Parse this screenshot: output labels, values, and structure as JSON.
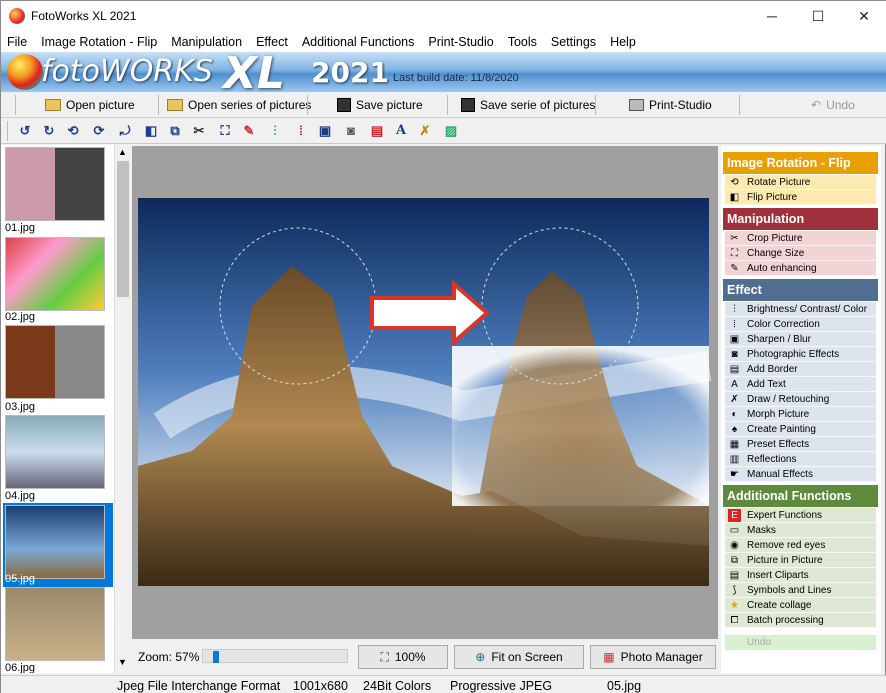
{
  "window": {
    "title": "FotoWorks XL 2021",
    "minimize": "─",
    "maximize": "☐",
    "close": "✕"
  },
  "menu": [
    "File",
    "Image Rotation - Flip",
    "Manipulation",
    "Effect",
    "Additional Functions",
    "Print-Studio",
    "Tools",
    "Settings",
    "Help"
  ],
  "banner": {
    "logo": "fotoWORKS",
    "xl": "XL",
    "year": "2021",
    "build": "Last build date: 11/8/2020"
  },
  "toolbar": {
    "open": "Open picture",
    "open_series": "Open series of pictures",
    "save": "Save picture",
    "save_series": "Save serie of pictures",
    "print": "Print-Studio",
    "undo": "Undo"
  },
  "thumbs": [
    "01.jpg",
    "02.jpg",
    "03.jpg",
    "04.jpg",
    "05.jpg",
    "06.jpg"
  ],
  "selected_thumb": "05.jpg",
  "zoom": {
    "label": "Zoom: 57%",
    "value": 57,
    "btn_100": "100%",
    "btn_fit": "Fit on Screen",
    "btn_pm": "Photo Manager"
  },
  "sidebar": {
    "g1": {
      "title": "Image Rotation - Flip",
      "color": "#e8a000",
      "bg": "#fdeab0",
      "items": [
        "Rotate Picture",
        "Flip Picture"
      ]
    },
    "g2": {
      "title": "Manipulation",
      "color": "#a0303c",
      "bg": "#f3d4d4",
      "items": [
        "Crop Picture",
        "Change Size",
        "Auto enhancing"
      ]
    },
    "g3": {
      "title": "Effect",
      "color": "#4f6e90",
      "bg": "#dce5ee",
      "items": [
        "Brightness/ Contrast/ Color",
        "Color Correction",
        "Sharpen / Blur",
        "Photographic Effects",
        "Add Border",
        "Add Text",
        "Draw / Retouching",
        "Morph Picture",
        "Create Painting",
        "Preset Effects",
        "Reflections",
        "Manual Effects"
      ]
    },
    "g4": {
      "title": "Additional Functions",
      "color": "#5e8a3c",
      "bg": "#dfe8d4",
      "items": [
        "Expert Functions",
        "Masks",
        "Remove red eyes",
        "Picture in Picture",
        "Insert Cliparts",
        "Symbols and Lines",
        "Create collage",
        "Batch processing"
      ]
    },
    "undo": "Undo"
  },
  "status": {
    "format": "Jpeg File Interchange Format",
    "dims": "1001x680",
    "colors": "24Bit Colors",
    "prog": "Progressive JPEG",
    "file": "05.jpg"
  }
}
